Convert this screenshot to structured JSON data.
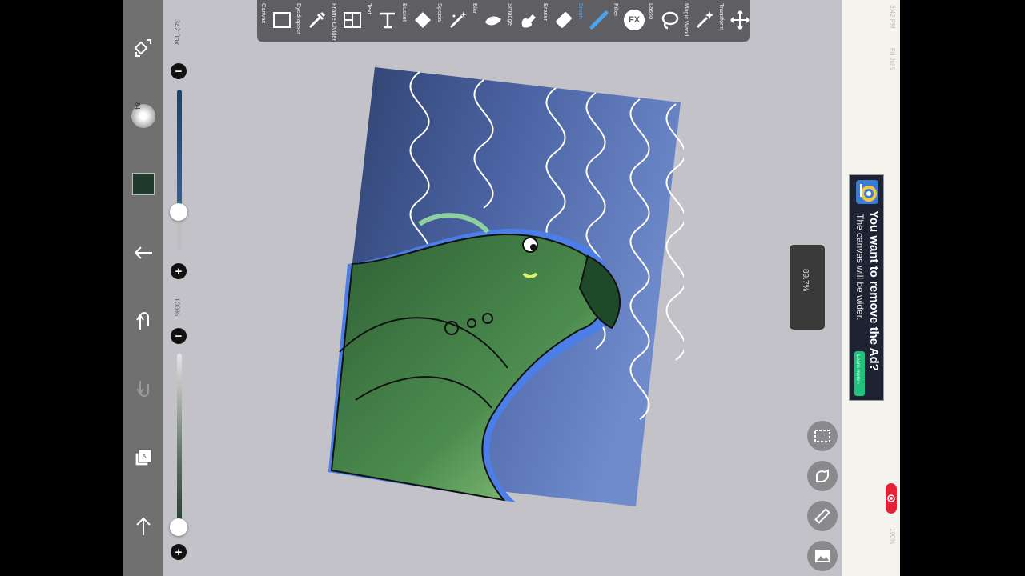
{
  "app": {
    "name": "ibisPaint"
  },
  "toolbar": {
    "tools": [
      {
        "label": "Canvas",
        "icon": "canvas-icon"
      },
      {
        "label": "Eyedropper",
        "icon": "eyedropper-icon"
      },
      {
        "label": "Frame Divider",
        "icon": "frame-divider-icon"
      },
      {
        "label": "Text",
        "icon": "text-icon"
      },
      {
        "label": "Bucket",
        "icon": "bucket-icon"
      },
      {
        "label": "Special",
        "icon": "special-icon"
      },
      {
        "label": "Blur",
        "icon": "blur-icon"
      },
      {
        "label": "Smudge",
        "icon": "smudge-icon"
      },
      {
        "label": "Eraser",
        "icon": "eraser-icon"
      },
      {
        "label": "Brush",
        "icon": "brush-icon",
        "active": true
      },
      {
        "label": "Filter",
        "icon": "filter-icon"
      },
      {
        "label": "Lasso",
        "icon": "lasso-icon"
      },
      {
        "label": "Magic Wand",
        "icon": "magic-wand-icon"
      },
      {
        "label": "Transform",
        "icon": "transform-icon"
      }
    ],
    "fx_text": "FX",
    "active_color": "#4aa3f0"
  },
  "left_panel": {
    "brush_size": "342.0px",
    "opacity": "100%",
    "current_color": "#213a2e",
    "brush_badge": "84"
  },
  "canvas": {
    "zoom": "89.7%"
  },
  "ad": {
    "title": "You want to remove the Ad?",
    "subtitle": "The canvas will be wider.",
    "button": "Learn more ›"
  },
  "status_bar": {
    "time": "3:42 PM",
    "date": "Fri Jul 9",
    "battery": "100%"
  },
  "colors": {
    "toolbar_bg": "#5f5f63",
    "side_bar_bg": "#707070",
    "workspace_bg": "#c3c2c8",
    "ad_accent": "#1ec27a",
    "record_red": "#e62238"
  }
}
